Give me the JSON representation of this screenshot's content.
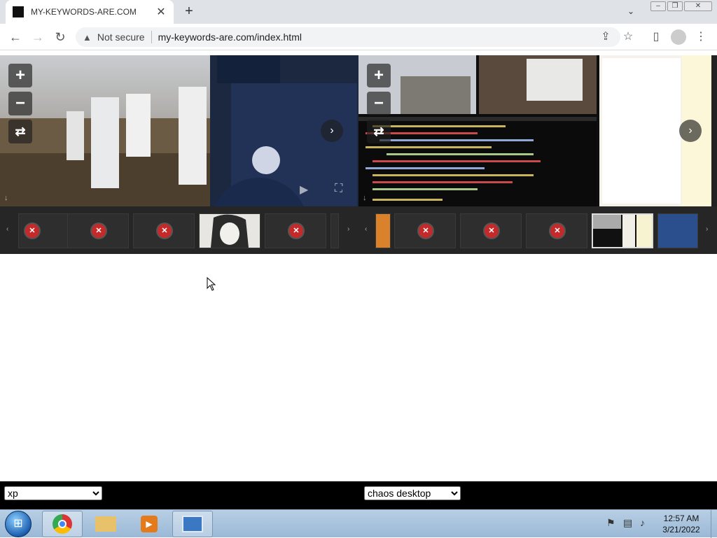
{
  "browser": {
    "tab_title": "MY-KEYWORDS-ARE.COM",
    "tab_close": "✕",
    "new_tab": "+",
    "security_label": "Not secure",
    "url": "my-keywords-are.com/index.html"
  },
  "viewer_controls": {
    "zoom_in": "+",
    "zoom_out": "−",
    "rotate": "⇄",
    "next": "›",
    "prev_thumb": "‹",
    "next_thumb": "›",
    "play": "▶",
    "fullscreen": "⛶",
    "download": "↓"
  },
  "thumbs": {
    "error_badge": "✕"
  },
  "selects": {
    "left": {
      "selected": "xp",
      "options": [
        "xp"
      ]
    },
    "right": {
      "selected": "chaos desktop",
      "options": [
        "chaos desktop"
      ]
    }
  },
  "taskbar": {
    "time": "12:57 AM",
    "date": "3/21/2022"
  }
}
